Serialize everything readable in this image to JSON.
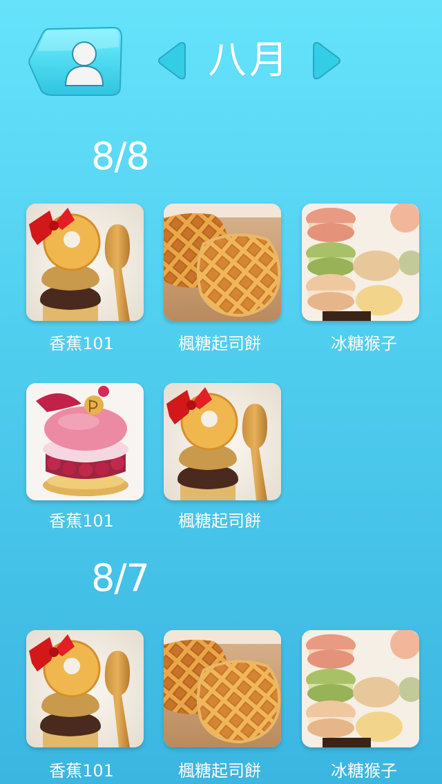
{
  "header": {
    "month_title": "八月",
    "profile_icon": "user-icon",
    "prev_icon": "chevron-left-icon",
    "next_icon": "chevron-right-icon"
  },
  "colors": {
    "background_top": "#66e3fb",
    "background_bottom": "#3bb6e1",
    "accent": "#41d3ea",
    "text": "#ffffff"
  },
  "sections": [
    {
      "date": "8/8",
      "items": [
        {
          "label": "香蕉101",
          "image": "donut-tower"
        },
        {
          "label": "楓糖起司餅",
          "image": "waffle"
        },
        {
          "label": "冰糖猴子",
          "image": "macarons"
        },
        {
          "label": "香蕉101",
          "image": "raspberry-macaron"
        },
        {
          "label": "楓糖起司餅",
          "image": "donut-tower"
        }
      ]
    },
    {
      "date": "8/7",
      "items": [
        {
          "label": "香蕉101",
          "image": "donut-tower"
        },
        {
          "label": "楓糖起司餅",
          "image": "waffle"
        },
        {
          "label": "冰糖猴子",
          "image": "macarons"
        }
      ]
    }
  ]
}
